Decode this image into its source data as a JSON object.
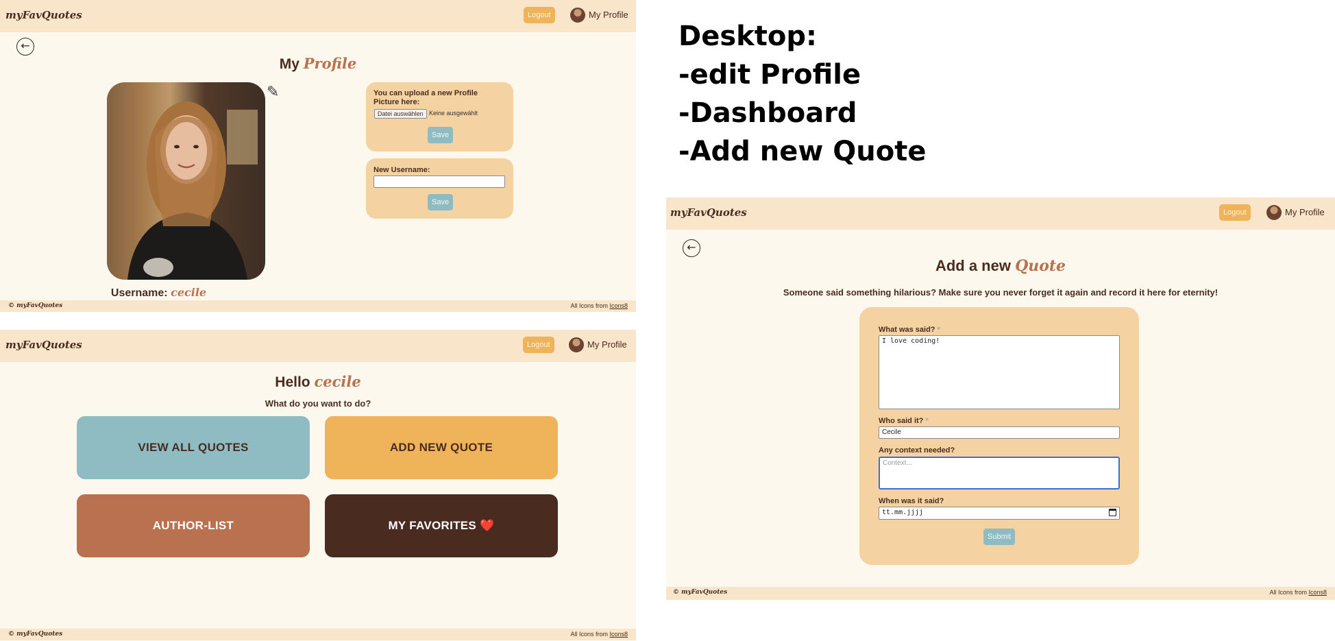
{
  "app": {
    "logo": "myFavQuotes",
    "logout": "Logout",
    "my_profile": "My Profile"
  },
  "footer": {
    "copy": "© myFavQuotes",
    "credits_prefix": "All Icons from ",
    "credits_link": "Icons8"
  },
  "profile_page": {
    "title_plain": "My ",
    "title_accent": "Profile",
    "upload_text": "You can upload a new Profile Picture here:",
    "file_button": "Datei auswählen",
    "file_none": "Keine ausgewählt",
    "save": "Save",
    "new_username_label": "New Username:",
    "username_label": "Username: ",
    "username_value": "cecile"
  },
  "dashboard_page": {
    "greeting": "Hello ",
    "user": "cecile",
    "question": "What do you want to do?",
    "tiles": [
      {
        "label": "VIEW ALL QUOTES",
        "color": "#8fbcc2",
        "text_color": "#4a2b20"
      },
      {
        "label": "ADD NEW QUOTE",
        "color": "#efb35a",
        "text_color": "#4a2b20"
      },
      {
        "label": "AUTHOR-LIST",
        "color": "#b9714f",
        "text_color": "#ffffff"
      },
      {
        "label": "MY FAVORITES ❤️",
        "color": "#4a2b20",
        "text_color": "#ffffff"
      }
    ]
  },
  "annotation": {
    "lines": [
      "Desktop:",
      "-edit Profile",
      "-Dashboard",
      "-Add new Quote"
    ]
  },
  "add_quote_page": {
    "title_plain": "Add a new ",
    "title_accent": "Quote",
    "subtitle": "Someone said something hilarious? Make sure you never forget it again and record it here for eternity!",
    "what_label": "What was said?",
    "what_value": "I love coding!",
    "who_label": "Who said it?",
    "who_value": "Cecile",
    "context_label": "Any context needed?",
    "context_placeholder": "Context...",
    "when_label": "When was it said?",
    "when_value": "tt.mm.jjjj",
    "required_mark": "*",
    "submit": "Submit"
  },
  "colors": {
    "navbar": "#f9e5c9",
    "page_bg": "#fdf8ee",
    "card": "#f4d2a2",
    "accent": "#b9714f",
    "dark": "#4a2b20",
    "button": "#efb35a",
    "save": "#8fbcc2"
  }
}
